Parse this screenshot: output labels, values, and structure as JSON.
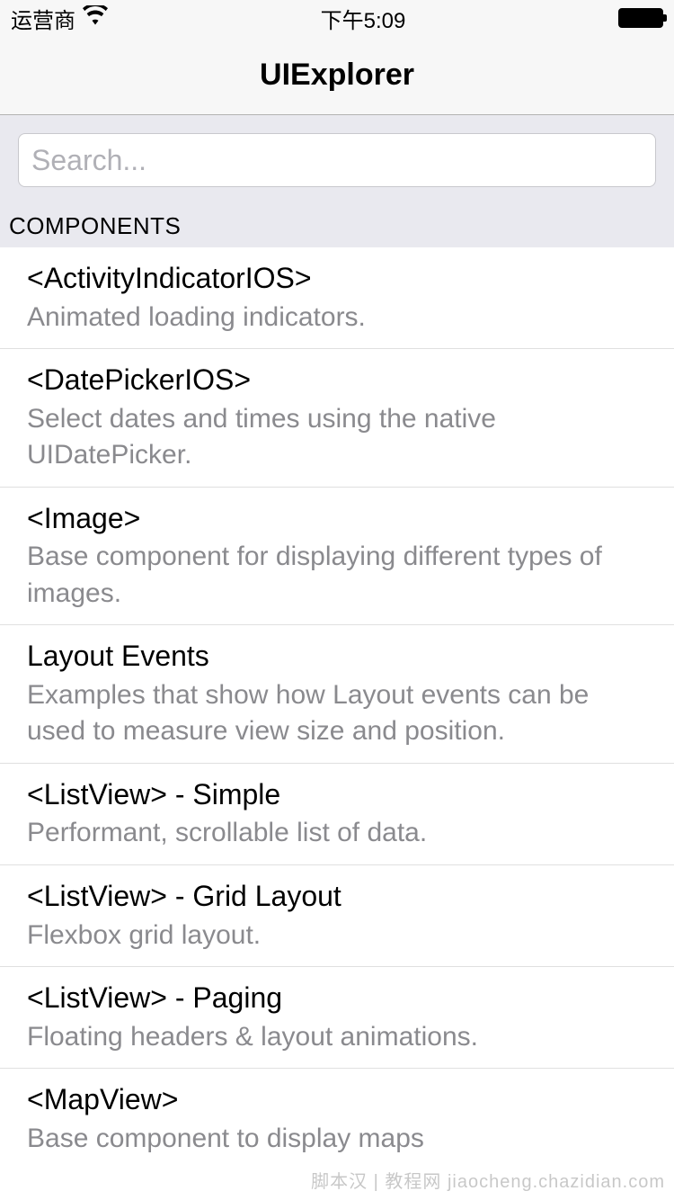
{
  "status_bar": {
    "carrier": "运营商",
    "time": "下午5:09"
  },
  "nav": {
    "title": "UIExplorer"
  },
  "search": {
    "placeholder": "Search...",
    "value": ""
  },
  "section": {
    "header": "COMPONENTS",
    "items": [
      {
        "title": "<ActivityIndicatorIOS>",
        "desc": "Animated loading indicators."
      },
      {
        "title": "<DatePickerIOS>",
        "desc": "Select dates and times using the native UIDatePicker."
      },
      {
        "title": "<Image>",
        "desc": "Base component for displaying different types of images."
      },
      {
        "title": "Layout Events",
        "desc": "Examples that show how Layout events can be used to measure view size and position."
      },
      {
        "title": "<ListView> - Simple",
        "desc": "Performant, scrollable list of data."
      },
      {
        "title": "<ListView> - Grid Layout",
        "desc": "Flexbox grid layout."
      },
      {
        "title": "<ListView> - Paging",
        "desc": "Floating headers & layout animations."
      },
      {
        "title": "<MapView>",
        "desc": "Base component to display maps"
      }
    ]
  },
  "watermark": "脚本汉 | 教程网  jiaocheng.chazidian.com"
}
